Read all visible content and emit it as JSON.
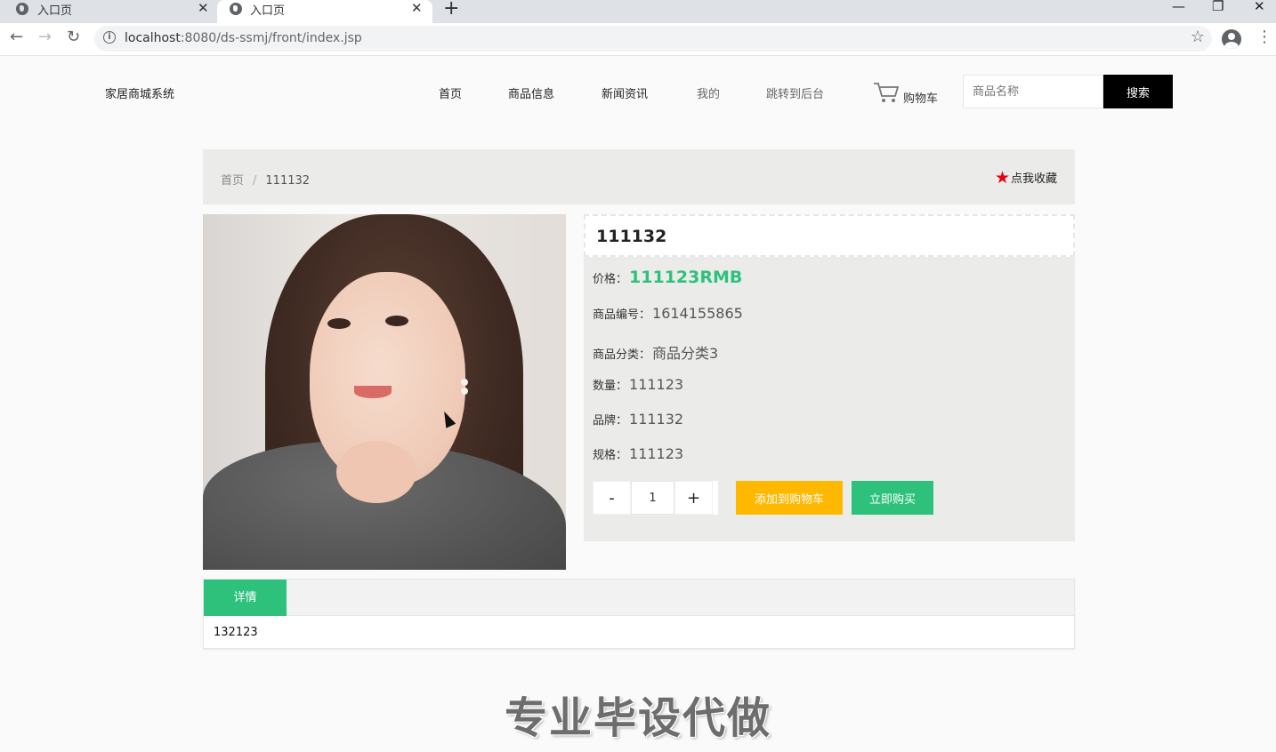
{
  "browser": {
    "tabs": [
      {
        "title": "入口页",
        "active": false
      },
      {
        "title": "入口页",
        "active": true
      }
    ],
    "url_host": "localhost",
    "url_rest": ":8080/ds-ssmj/front/index.jsp"
  },
  "header": {
    "brand": "家居商城系统",
    "nav": [
      "首页",
      "商品信息",
      "新闻资讯",
      "我的",
      "跳转到后台"
    ],
    "cart_label": "购物车",
    "search_placeholder": "商品名称",
    "search_button": "搜索"
  },
  "breadcrumb": {
    "home": "首页",
    "separator": "/",
    "current": "111132"
  },
  "favorite_label": "点我收藏",
  "product": {
    "name": "111132",
    "price_label": "价格：",
    "price": "111123RMB",
    "code_label": "商品编号：",
    "code": "1614155865",
    "category_label": "商品分类：",
    "category": "商品分类3",
    "quantity_label": "数量：",
    "quantity": "111123",
    "brand_label": "品牌：",
    "brand": "111132",
    "spec_label": "规格：",
    "spec": "111123"
  },
  "purchase": {
    "minus": "-",
    "qty": "1",
    "plus": "+",
    "add_to_cart": "添加到购物车",
    "buy_now": "立即购买"
  },
  "detail": {
    "tab_label": "详情",
    "content": "132123"
  },
  "watermark": "专业毕设代做",
  "colors": {
    "accent_green": "#2ec17c",
    "cart_button": "#ffb800",
    "favorite_star": "#e60012"
  }
}
